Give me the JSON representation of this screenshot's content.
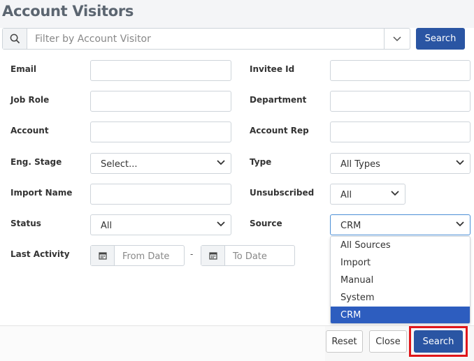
{
  "page": {
    "title": "Account Visitors"
  },
  "filter_bar": {
    "placeholder": "Filter by Account Visitor",
    "search_label": "Search"
  },
  "form": {
    "fields": {
      "email": {
        "label": "Email",
        "value": ""
      },
      "invitee_id": {
        "label": "Invitee Id",
        "value": ""
      },
      "job_role": {
        "label": "Job Role",
        "value": ""
      },
      "department": {
        "label": "Department",
        "value": ""
      },
      "account": {
        "label": "Account",
        "value": ""
      },
      "account_rep": {
        "label": "Account Rep",
        "value": ""
      },
      "eng_stage": {
        "label": "Eng. Stage",
        "value": "Select..."
      },
      "type": {
        "label": "Type",
        "value": "All Types"
      },
      "import_name": {
        "label": "Import Name",
        "value": ""
      },
      "unsubscribed": {
        "label": "Unsubscribed",
        "value": "All"
      },
      "status": {
        "label": "Status",
        "value": "All"
      },
      "source": {
        "label": "Source",
        "value": "CRM"
      },
      "last_activity": {
        "label": "Last Activity",
        "from_placeholder": "From Date",
        "to_placeholder": "To Date",
        "separator": "-"
      }
    },
    "source_options": [
      "All Sources",
      "Import",
      "Manual",
      "System",
      "CRM"
    ],
    "source_selected_index": 4
  },
  "footer": {
    "reset_label": "Reset",
    "close_label": "Close",
    "search_label": "Search"
  },
  "colors": {
    "primary": "#2a55a3",
    "selected_option": "#2d5dbf",
    "highlight": "#e0161a"
  },
  "icons": {
    "search": "search-icon",
    "chevron": "chevron-down-icon",
    "calendar": "calendar-icon"
  }
}
